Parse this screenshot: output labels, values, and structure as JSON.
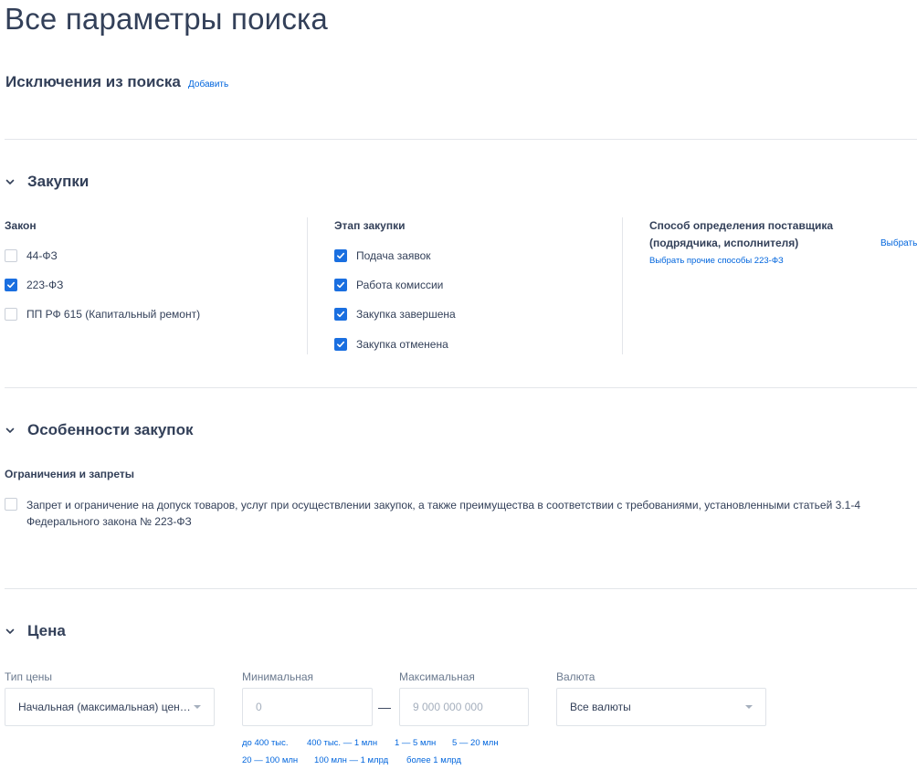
{
  "page": {
    "title": "Все параметры поиска"
  },
  "exclusions": {
    "title": "Исключения из поиска",
    "add_label": "Добавить"
  },
  "purchases": {
    "title": "Закупки",
    "law": {
      "title": "Закон",
      "options": [
        {
          "label": "44-ФЗ",
          "checked": false
        },
        {
          "label": "223-ФЗ",
          "checked": true
        },
        {
          "label": "ПП РФ 615 (Капитальный ремонт)",
          "checked": false
        }
      ]
    },
    "stage": {
      "title": "Этап закупки",
      "options": [
        {
          "label": "Подача заявок",
          "checked": true
        },
        {
          "label": "Работа комиссии",
          "checked": true
        },
        {
          "label": "Закупка завершена",
          "checked": true
        },
        {
          "label": "Закупка отменена",
          "checked": true
        }
      ]
    },
    "method": {
      "title_line1": "Способ определения поставщика",
      "title_line2": "(подрядчика, исполнителя)",
      "choose_label": "Выбрать",
      "other_label": "Выбрать прочие способы 223-ФЗ"
    }
  },
  "features": {
    "title": "Особенности закупок",
    "restrictions": {
      "title": "Ограничения и запреты",
      "option": {
        "label": "Запрет и ограничение на допуск товаров, услуг при осуществлении закупок, а также преимущества в соответствии с требованиями, установленными статьей 3.1-4 Федерального закона № 223-ФЗ",
        "checked": false
      }
    }
  },
  "price": {
    "title": "Цена",
    "type": {
      "label": "Тип цены",
      "value": "Начальная (максимальная) цена к..."
    },
    "min": {
      "label": "Минимальная",
      "placeholder": "0"
    },
    "dash": "—",
    "max": {
      "label": "Максимальная",
      "placeholder": "9 000 000 000"
    },
    "currency": {
      "label": "Валюта",
      "value": "Все валюты"
    },
    "presets_row1": [
      "до 400 тыс.",
      "400 тыс. — 1 млн",
      "1 — 5 млн",
      "5 — 20 млн"
    ],
    "presets_row2": [
      "20 — 100 млн",
      "100 млн — 1 млрд",
      "более 1 млрд"
    ]
  },
  "colors": {
    "accent": "#0065dd",
    "checkbox": "#1a6fe0",
    "text": "#334059",
    "muted": "#6b7a8f",
    "divider": "#e3e6ea"
  }
}
